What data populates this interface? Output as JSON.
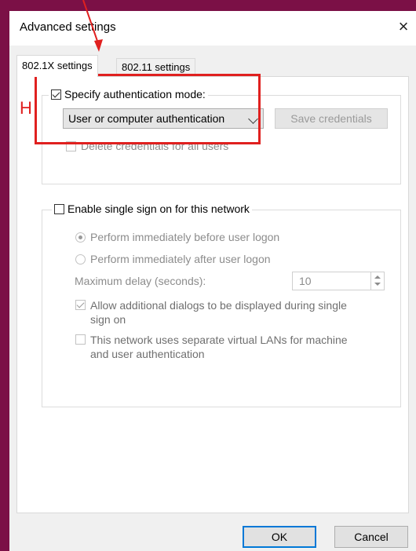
{
  "dialog": {
    "title": "Advanced settings",
    "close": "×"
  },
  "tabs": [
    {
      "label": "802.1X settings",
      "active": true
    },
    {
      "label": "802.11 settings",
      "active": false
    }
  ],
  "auth_group": {
    "specify_label": "Specify authentication mode:",
    "specify_checked": true,
    "mode_value": "User or computer authentication",
    "save_credentials": "Save credentials",
    "delete_credentials": "Delete credentials for all users",
    "delete_checked": false
  },
  "sso_group": {
    "enable_label": "Enable single sign on for this network",
    "enable_checked": false,
    "radio_before": "Perform immediately before user logon",
    "radio_after": "Perform immediately after user logon",
    "selected_radio": "before",
    "max_delay_label": "Maximum delay (seconds):",
    "max_delay_value": "10",
    "allow_dialogs": "Allow additional dialogs to be displayed during single sign on",
    "allow_dialogs_line1": "Allow additional dialogs to be displayed during single",
    "allow_dialogs_line2": "sign on",
    "allow_checked": true,
    "separate_vlans_line1": "This network uses separate virtual LANs for machine",
    "separate_vlans_line2": "and user authentication",
    "separate_checked": false
  },
  "annotation": {
    "marker": "H",
    "color": "#e0201f"
  },
  "buttons": {
    "ok": "OK",
    "cancel": "Cancel"
  }
}
